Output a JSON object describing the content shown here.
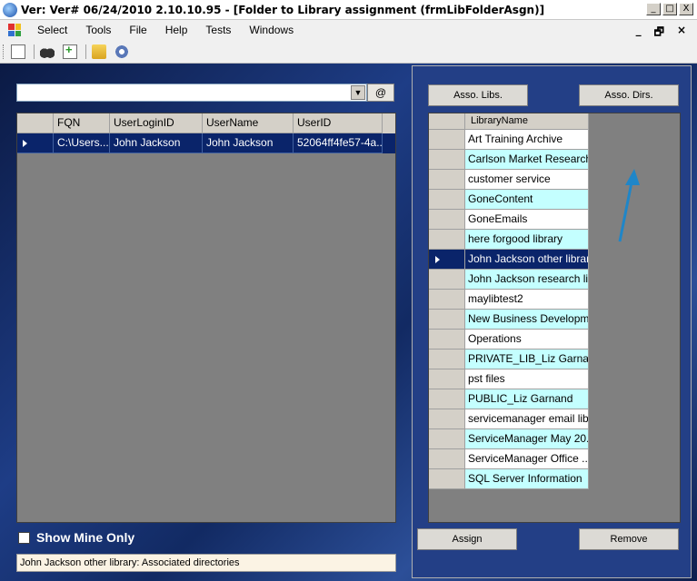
{
  "window": {
    "title": "Ver: Ver# 06/24/2010 2.10.10.95 - [Folder to Library assignment  (frmLibFolderAsgn)]",
    "buttons": [
      "_",
      "□",
      "X"
    ]
  },
  "menubar": {
    "items": [
      "Select",
      "Tools",
      "File",
      "Help",
      "Tests",
      "Windows"
    ],
    "mdi_buttons": [
      "_",
      "🗗",
      "×"
    ]
  },
  "toolbar": {
    "icons": [
      "new-document-icon",
      "binoculars-icon",
      "add-file-icon",
      "folder-icon",
      "gear-icon"
    ]
  },
  "left": {
    "combo_value": "",
    "at_button": "@",
    "grid": {
      "columns": [
        "",
        "FQN",
        "UserLoginID",
        "UserName",
        "UserID"
      ],
      "rows": [
        [
          "",
          "C:\\Users...",
          "John Jackson",
          "John Jackson",
          "52064ff4fe57-4a..."
        ]
      ]
    },
    "show_mine_only": "Show Mine Only",
    "status": "John Jackson other library: Associated directories"
  },
  "right": {
    "asso_libs": "Asso. Libs.",
    "asso_dirs": "Asso. Dirs.",
    "grid": {
      "header": "LibraryName",
      "rows": [
        "Art Training Archive",
        "Carlson Market Research",
        "customer service",
        "GoneContent",
        "GoneEmails",
        "here forgood library",
        "John Jackson other library",
        "John Jackson research li...",
        "maylibtest2",
        "New Business Developm...",
        "Operations",
        "PRIVATE_LIB_Liz Garna...",
        "pst files",
        "PUBLIC_Liz Garnand",
        "servicemanager email libr...",
        "ServiceManager May 20...",
        "ServiceManager Office ...",
        "SQL Server Information"
      ],
      "selected_index": 6
    },
    "assign": "Assign",
    "remove": "Remove"
  },
  "colors": {
    "selection": "#0a246a",
    "alt_row": "#c4ffff",
    "annotation_arrow": "#1f86c8"
  }
}
